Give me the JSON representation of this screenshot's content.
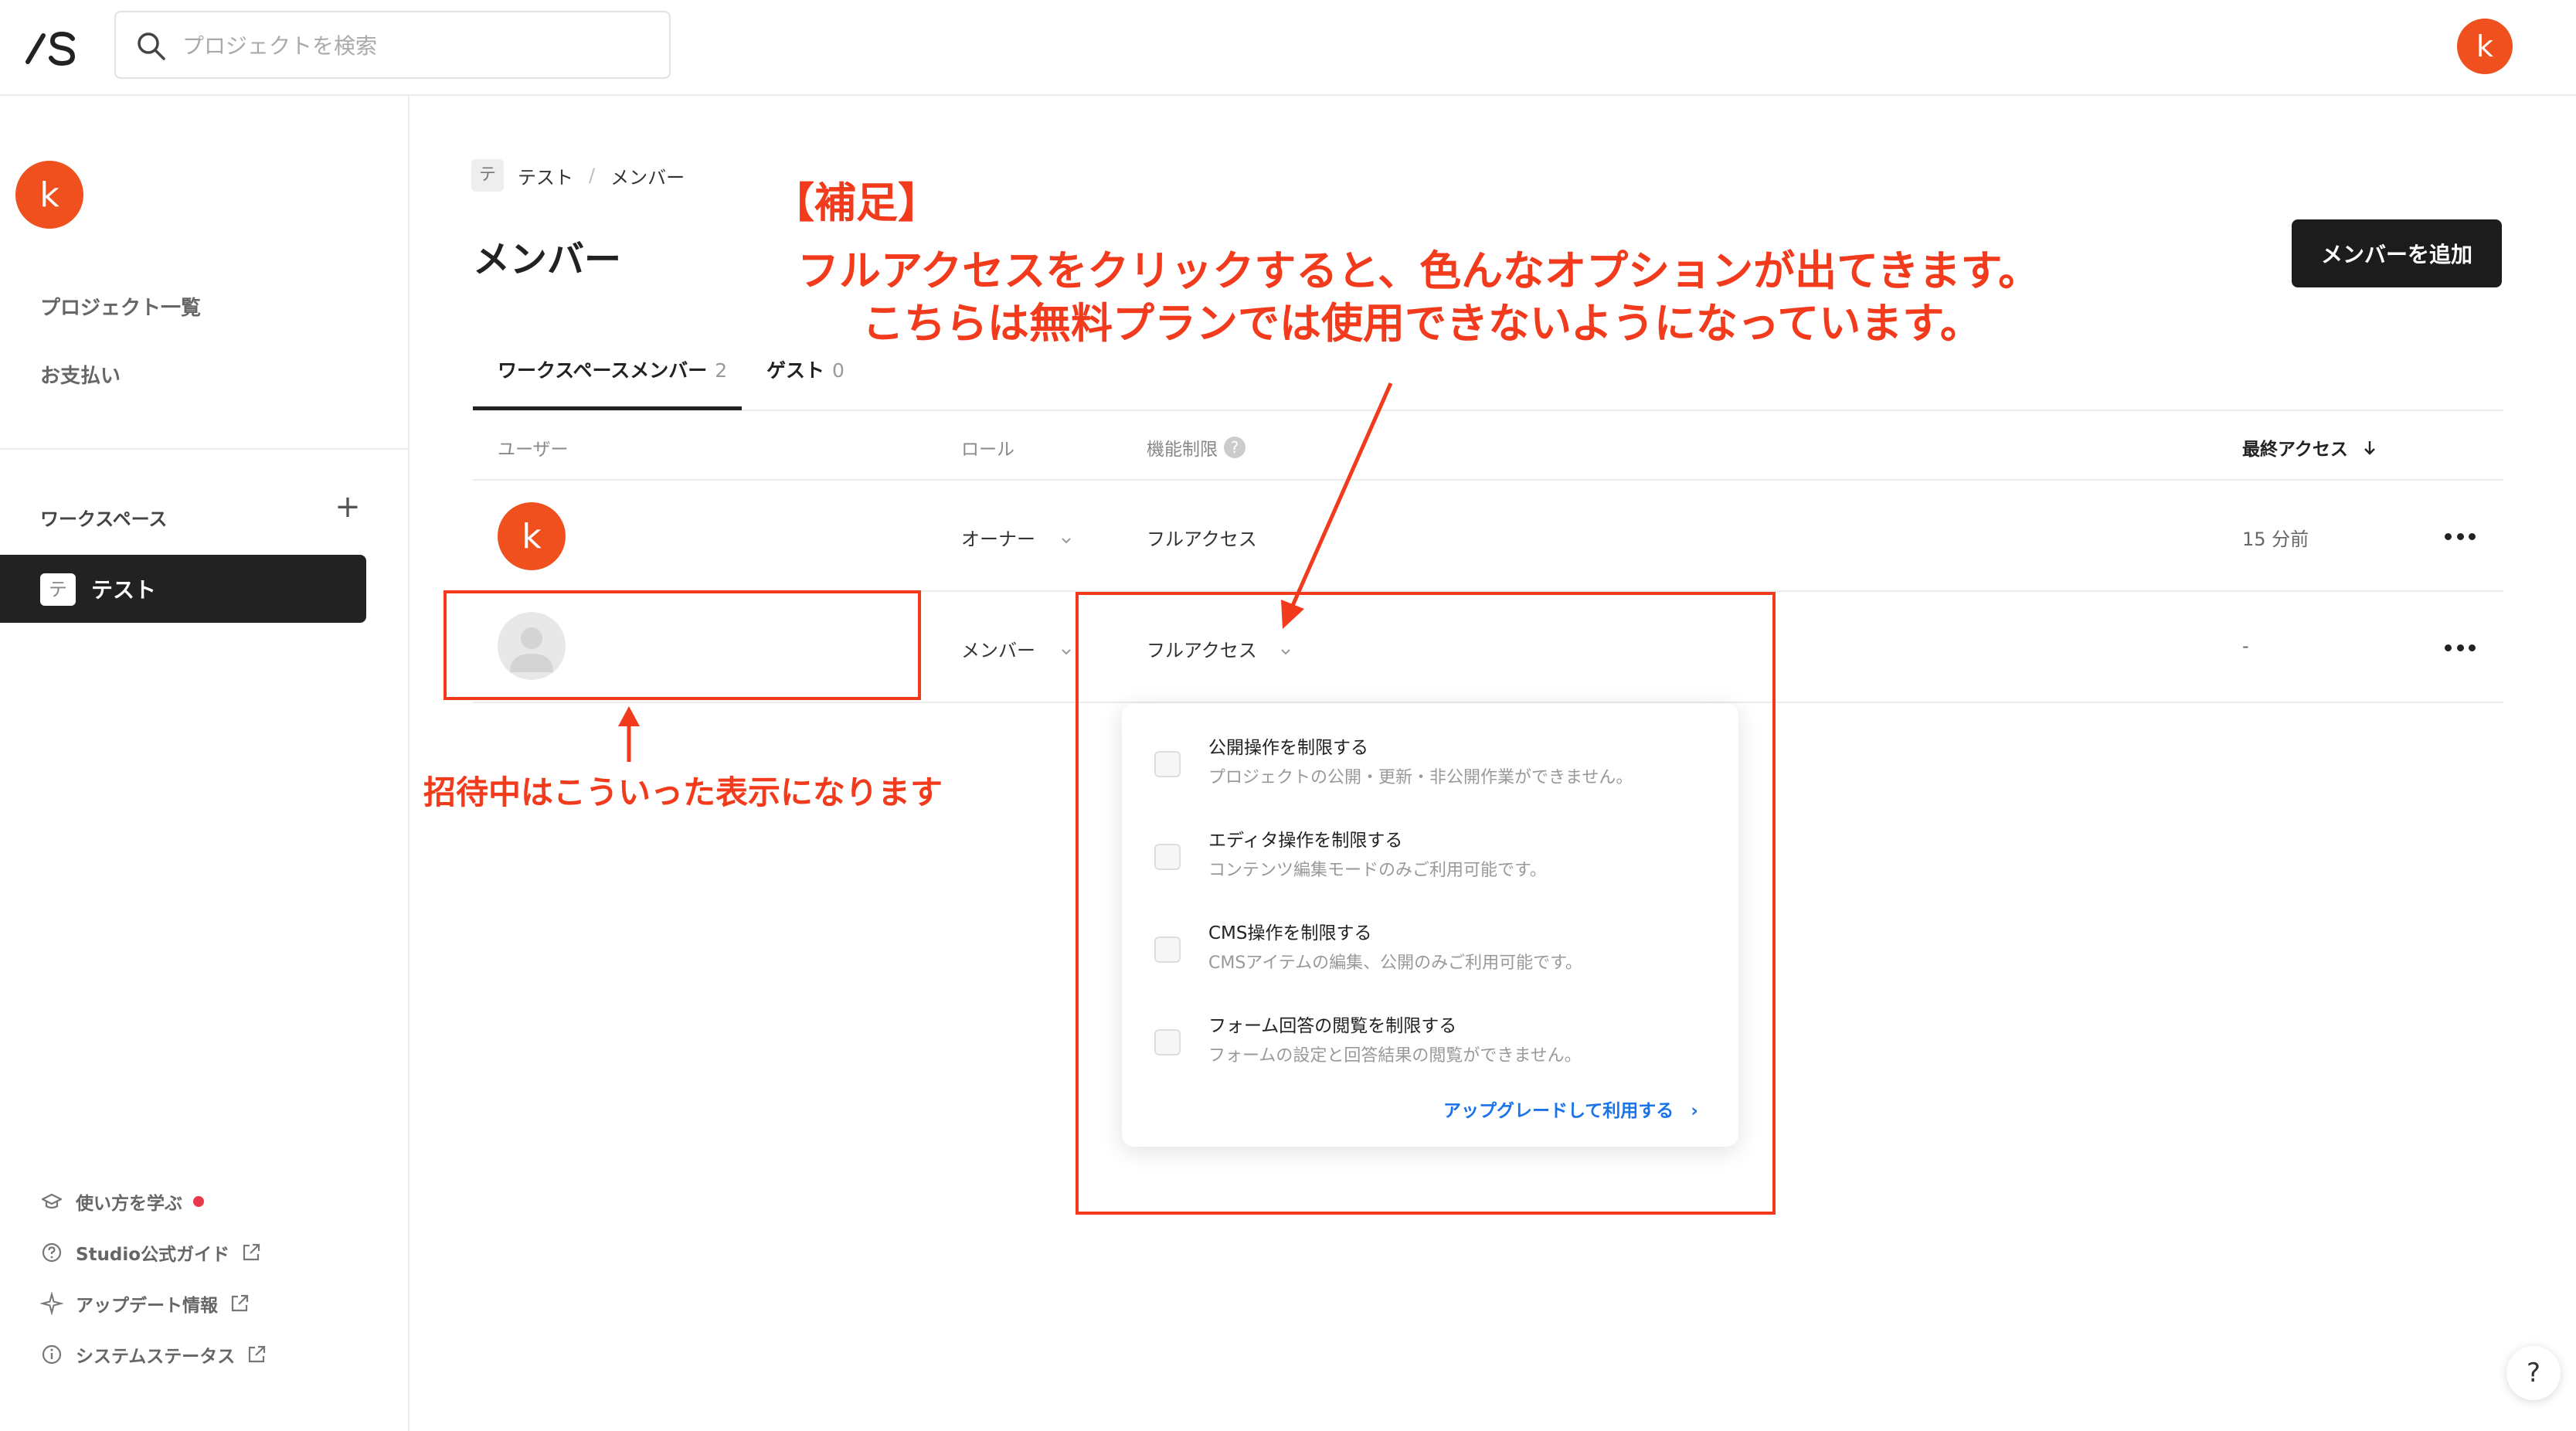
{
  "header": {
    "search_placeholder": "プロジェクトを検索",
    "user_initial": "k"
  },
  "sidebar": {
    "user_initial": "k",
    "links": [
      {
        "label": "プロジェクト一覧"
      },
      {
        "label": "お支払い"
      }
    ],
    "workspace_section_label": "ワークスペース",
    "workspace_add": "+",
    "workspace_item": {
      "icon_text": "テ",
      "label": "テスト"
    },
    "footer": [
      {
        "label": "使い方を学ぶ",
        "icon": "graduation-cap-icon"
      },
      {
        "label": "Studio公式ガイド",
        "icon": "question-circle-icon"
      },
      {
        "label": "アップデート情報",
        "icon": "sparkle-icon"
      },
      {
        "label": "システムステータス",
        "icon": "info-circle-icon"
      }
    ]
  },
  "breadcrumb": {
    "icon_text": "テ",
    "project": "テスト",
    "separator": "/",
    "page": "メンバー"
  },
  "page": {
    "title": "メンバー",
    "add_member_label": "メンバーを追加"
  },
  "tabs": [
    {
      "label": "ワークスペースメンバー",
      "count": "2"
    },
    {
      "label": "ゲスト",
      "count": "0"
    }
  ],
  "table": {
    "headers": {
      "user": "ユーザー",
      "role": "ロール",
      "restriction": "機能制限",
      "restriction_help": "?",
      "last_access": "最終アクセス"
    },
    "rows": [
      {
        "avatar_initial": "k",
        "role": "オーナー",
        "access": "フルアクセス",
        "last_access": "15 分前"
      },
      {
        "avatar_initial": "",
        "role": "メンバー",
        "access": "フルアクセス",
        "last_access": "-"
      }
    ]
  },
  "dropdown": {
    "options": [
      {
        "title": "公開操作を制限する",
        "desc": "プロジェクトの公開・更新・非公開作業ができません。"
      },
      {
        "title": "エディタ操作を制限する",
        "desc": "コンテンツ編集モードのみご利用可能です。"
      },
      {
        "title": "CMS操作を制限する",
        "desc": "CMSアイテムの編集、公開のみご利用可能です。"
      },
      {
        "title": "フォーム回答の閲覧を制限する",
        "desc": "フォームの設定と回答結果の閲覧ができません。"
      }
    ],
    "upgrade_label": "アップグレードして利用する",
    "upgrade_chevron": "›"
  },
  "annotations": {
    "supplement_title": "【補足】",
    "supplement_line1": "フルアクセスをクリックすると、色んなオプションが出てきます。",
    "supplement_line2": "こちらは無料プランでは使用できないようになっています。",
    "invite_note": "招待中はこういった表示になります"
  },
  "help_button": "?",
  "colors": {
    "accent_orange": "#f0501e",
    "annotation_red": "#f23a1c",
    "link_blue": "#1a73e8",
    "dark": "#1c1c1c"
  }
}
